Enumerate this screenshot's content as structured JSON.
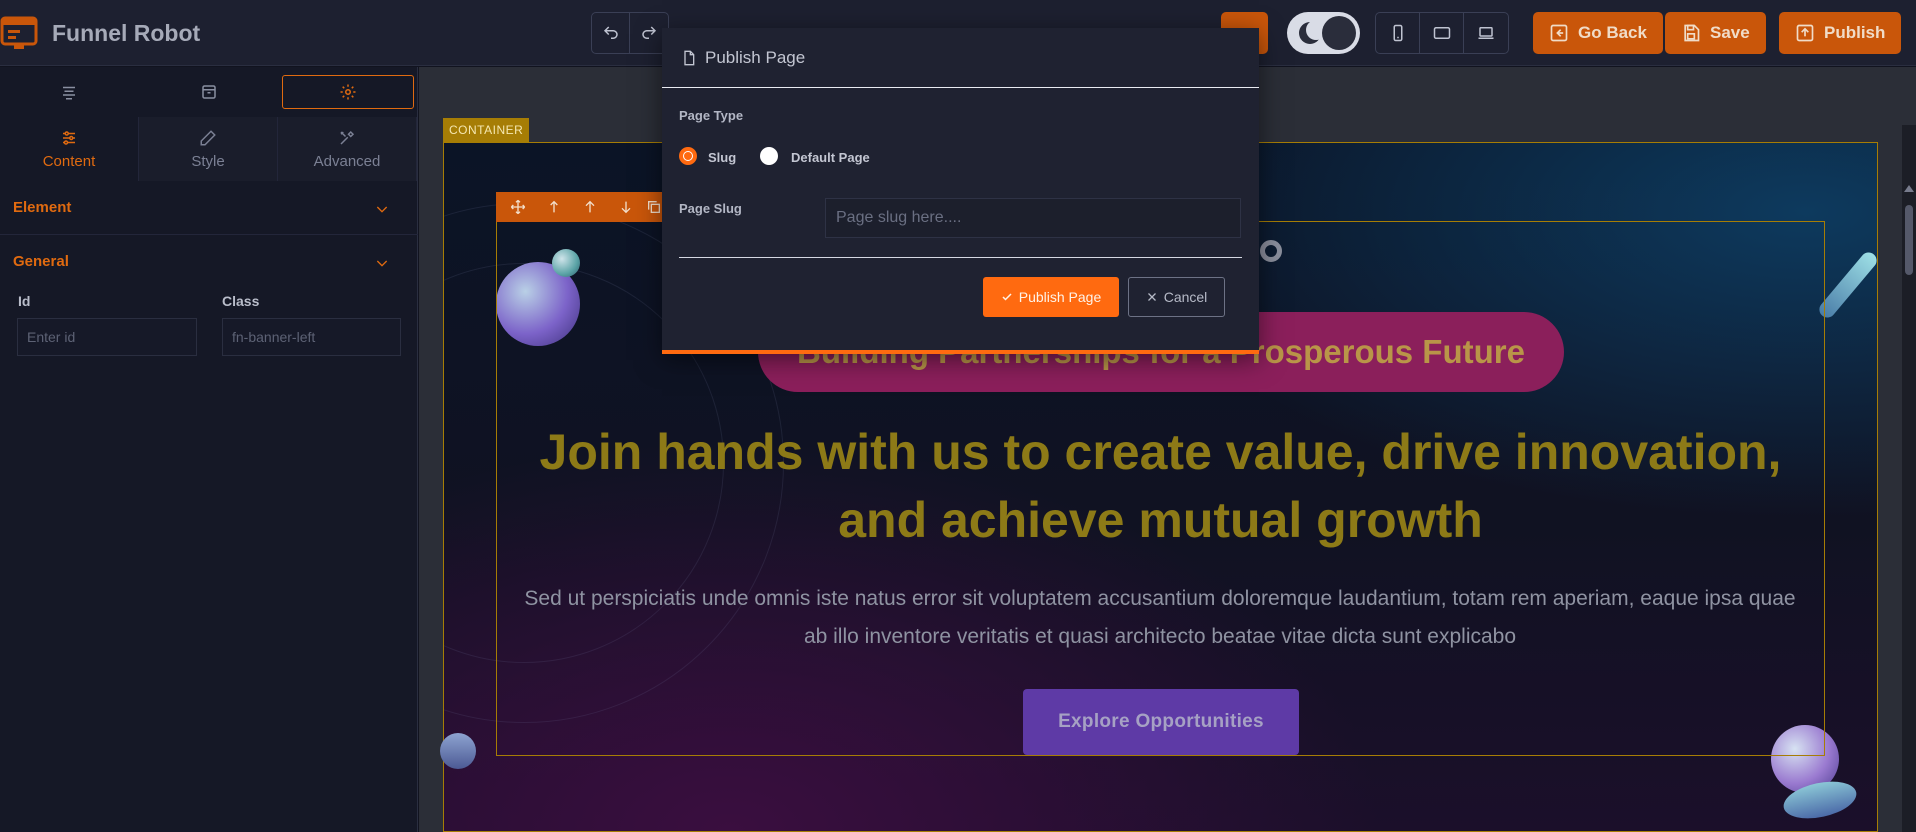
{
  "app": {
    "brand_name": "Funnel Robot"
  },
  "toolbar": {
    "undo_icon": "undo-icon",
    "redo_icon": "redo-icon",
    "device_icons": [
      "mobile-icon",
      "tablet-icon",
      "desktop-icon"
    ],
    "go_back_label": "Go Back",
    "save_label": "Save",
    "publish_label": "Publish"
  },
  "left_panel": {
    "tabs": [
      "layers-icon",
      "template-icon",
      "settings-icon"
    ],
    "subtabs": [
      {
        "label": "Content",
        "icon": "sliders-icon"
      },
      {
        "label": "Style",
        "icon": "pen-icon"
      },
      {
        "label": "Advanced",
        "icon": "tools-icon"
      }
    ],
    "sections": {
      "element": "Element",
      "general": "General"
    },
    "fields": {
      "id_label": "Id",
      "id_placeholder": "Enter id",
      "class_label": "Class",
      "class_value": "fn-banner-left"
    }
  },
  "canvas": {
    "container_label": "CONTAINER",
    "badge_text": "Building Partnerships for a Prosperous Future",
    "title": "Join hands with us to create value, drive innovation, and achieve mutual growth",
    "text": "Sed ut perspiciatis unde omnis iste natus error sit voluptatem accusantium doloremque laudantium, totam rem aperiam, eaque ipsa quae ab illo inventore veritatis et quasi architecto beatae vitae dicta sunt explicabo",
    "cta_label": "Explore Opportunities"
  },
  "modal": {
    "title": "Publish Page",
    "page_type_label": "Page Type",
    "options": [
      {
        "label": "Slug",
        "checked": true
      },
      {
        "label": "Default Page",
        "checked": false
      }
    ],
    "slug_label": "Page Slug",
    "slug_placeholder": "Page slug here....",
    "publish_button": "Publish Page",
    "cancel_button": "Cancel"
  },
  "colors": {
    "accent": "#ff6a10",
    "brand_orange": "#c9560a",
    "container_outline": "#a67d05",
    "badge": "#8b1f5b",
    "cta": "#5e3aa6"
  }
}
